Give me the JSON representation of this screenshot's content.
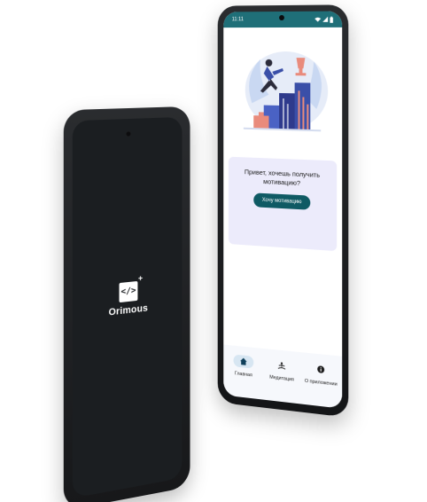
{
  "splash": {
    "app_name": "Orimous",
    "logo_glyph": "</>",
    "logo_plus": "+"
  },
  "app": {
    "status": {
      "time": "11:11"
    },
    "card": {
      "text": "Привет, хочешь получить мотивацию?",
      "button_label": "Хочу мотивацию"
    },
    "nav": {
      "items": [
        {
          "label": "Главная",
          "icon": "home-icon"
        },
        {
          "label": "Медитация",
          "icon": "meditation-icon"
        },
        {
          "label": "О приложении",
          "icon": "info-icon"
        }
      ]
    },
    "colors": {
      "accent": "#0f5a64",
      "status_bar": "#1f6f78",
      "card_bg": "#ecebfb",
      "nav_active_bg": "#d7e6f2"
    }
  }
}
